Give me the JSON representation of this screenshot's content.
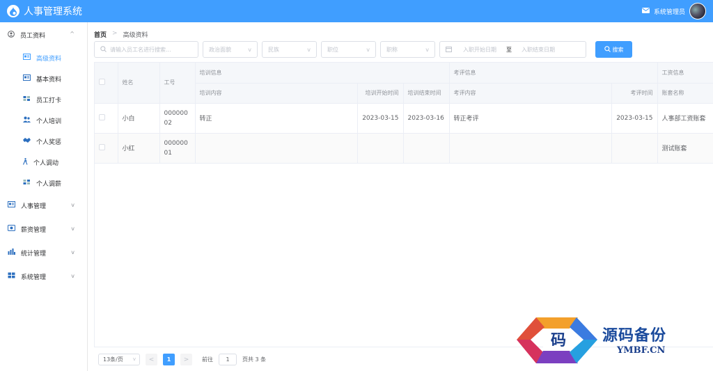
{
  "header": {
    "title": "人事管理系统",
    "user_name": "系统管理员"
  },
  "sidebar": {
    "groups": [
      {
        "label": "员工资料",
        "expanded": true
      },
      {
        "label": "人事管理"
      },
      {
        "label": "薪资管理"
      },
      {
        "label": "统计管理"
      },
      {
        "label": "系统管理"
      }
    ],
    "items": [
      {
        "label": "高级资料",
        "active": true
      },
      {
        "label": "基本资料"
      },
      {
        "label": "员工打卡"
      },
      {
        "label": "个人培训"
      },
      {
        "label": "个人奖惩"
      },
      {
        "label": "个人调动"
      },
      {
        "label": "个人调薪"
      }
    ]
  },
  "breadcrumb": {
    "home": "首页",
    "current": "高级资料"
  },
  "filters": {
    "search_placeholder": "请输入员工名进行搜索...",
    "political": "政治面貌",
    "nation": "民族",
    "position": "职位",
    "title": "职称",
    "date_start": "入职开始日期",
    "date_to": "至",
    "date_end": "入职结束日期",
    "search_label": "搜索"
  },
  "table": {
    "headers": {
      "name": "姓名",
      "work_id": "工号",
      "training_group": "培训信息",
      "training_content": "培训内容",
      "training_start": "培训开始时间",
      "training_end": "培训结束时间",
      "appraise_group": "考评信息",
      "appraise_content": "考评内容",
      "appraise_date": "考评时间",
      "salary_group": "工资信息",
      "salary_account": "账套名称"
    },
    "rows": [
      {
        "name": "小白",
        "work_id": "00000002",
        "training_content": "转正",
        "training_start": "2023-03-15",
        "training_end": "2023-03-16",
        "appraise_content": "转正考评",
        "appraise_date": "2023-03-15",
        "salary_account": "人事部工资账套"
      },
      {
        "name": "小红",
        "work_id": "00000001",
        "training_content": "",
        "training_start": "",
        "training_end": "",
        "appraise_content": "",
        "appraise_date": "",
        "salary_account": "测试账套"
      }
    ]
  },
  "pagination": {
    "page_size": "13条/页",
    "current_page": "1",
    "goto_label": "前往",
    "goto_value": "1",
    "total_label": "页共 3 条"
  },
  "watermark": {
    "text": "源码备份",
    "logo_char": "码",
    "domain": "YMBF.CN"
  },
  "colors": {
    "primary": "#409eff",
    "border": "#dcdfe6",
    "header_bg": "#f5f7fa"
  }
}
